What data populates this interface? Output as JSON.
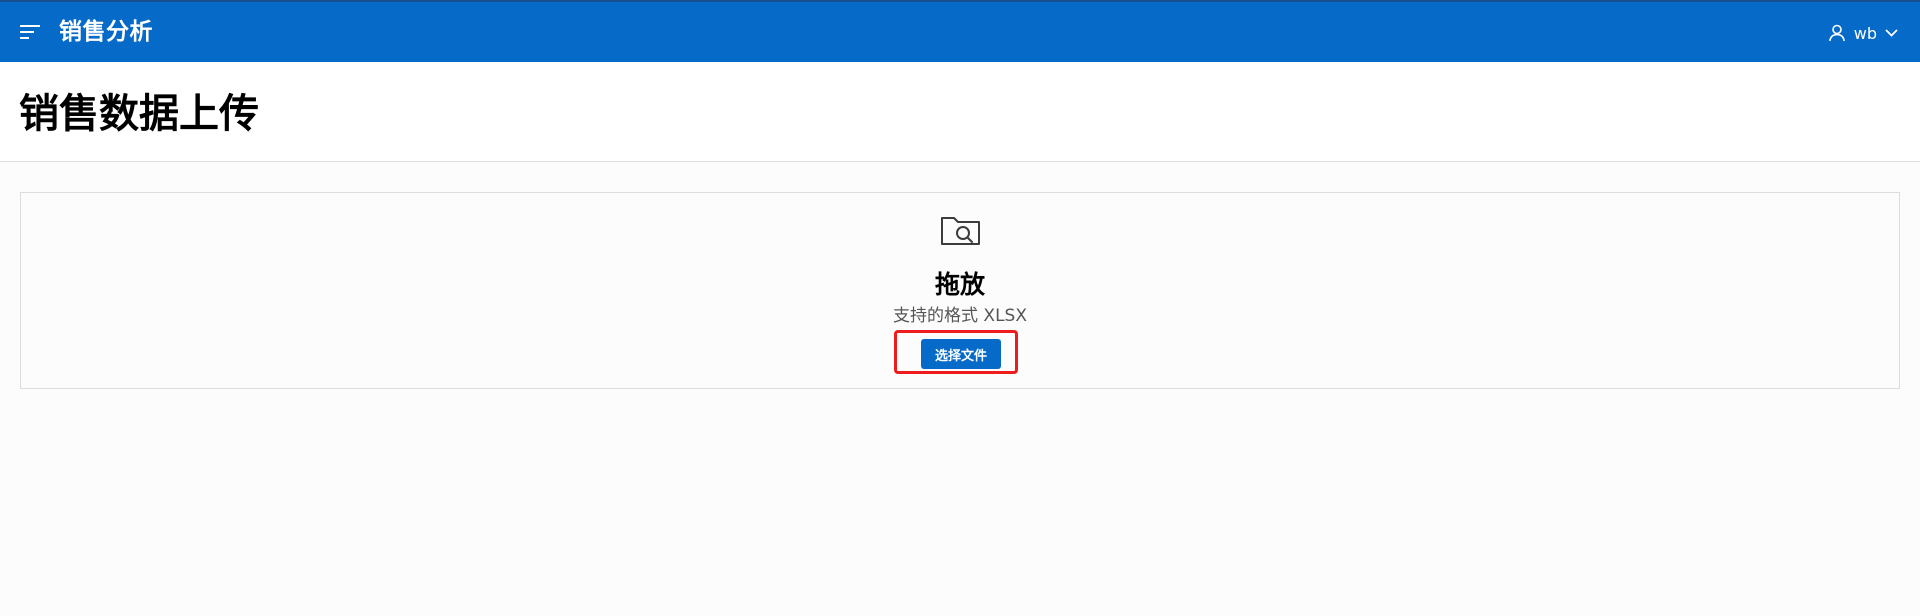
{
  "header": {
    "app_title": "销售分析",
    "user_name": "wb",
    "menu_icon": "hamburger-menu-icon",
    "user_icon": "user-icon",
    "dropdown_icon": "chevron-down-icon",
    "background_color": "#056ac8"
  },
  "page": {
    "title": "销售数据上传"
  },
  "upload": {
    "icon": "folder-search-icon",
    "drop_label": "拖放",
    "format_hint": "支持的格式 XLSX",
    "choose_button_label": "选择文件",
    "highlight_color": "#ee1c1c"
  }
}
